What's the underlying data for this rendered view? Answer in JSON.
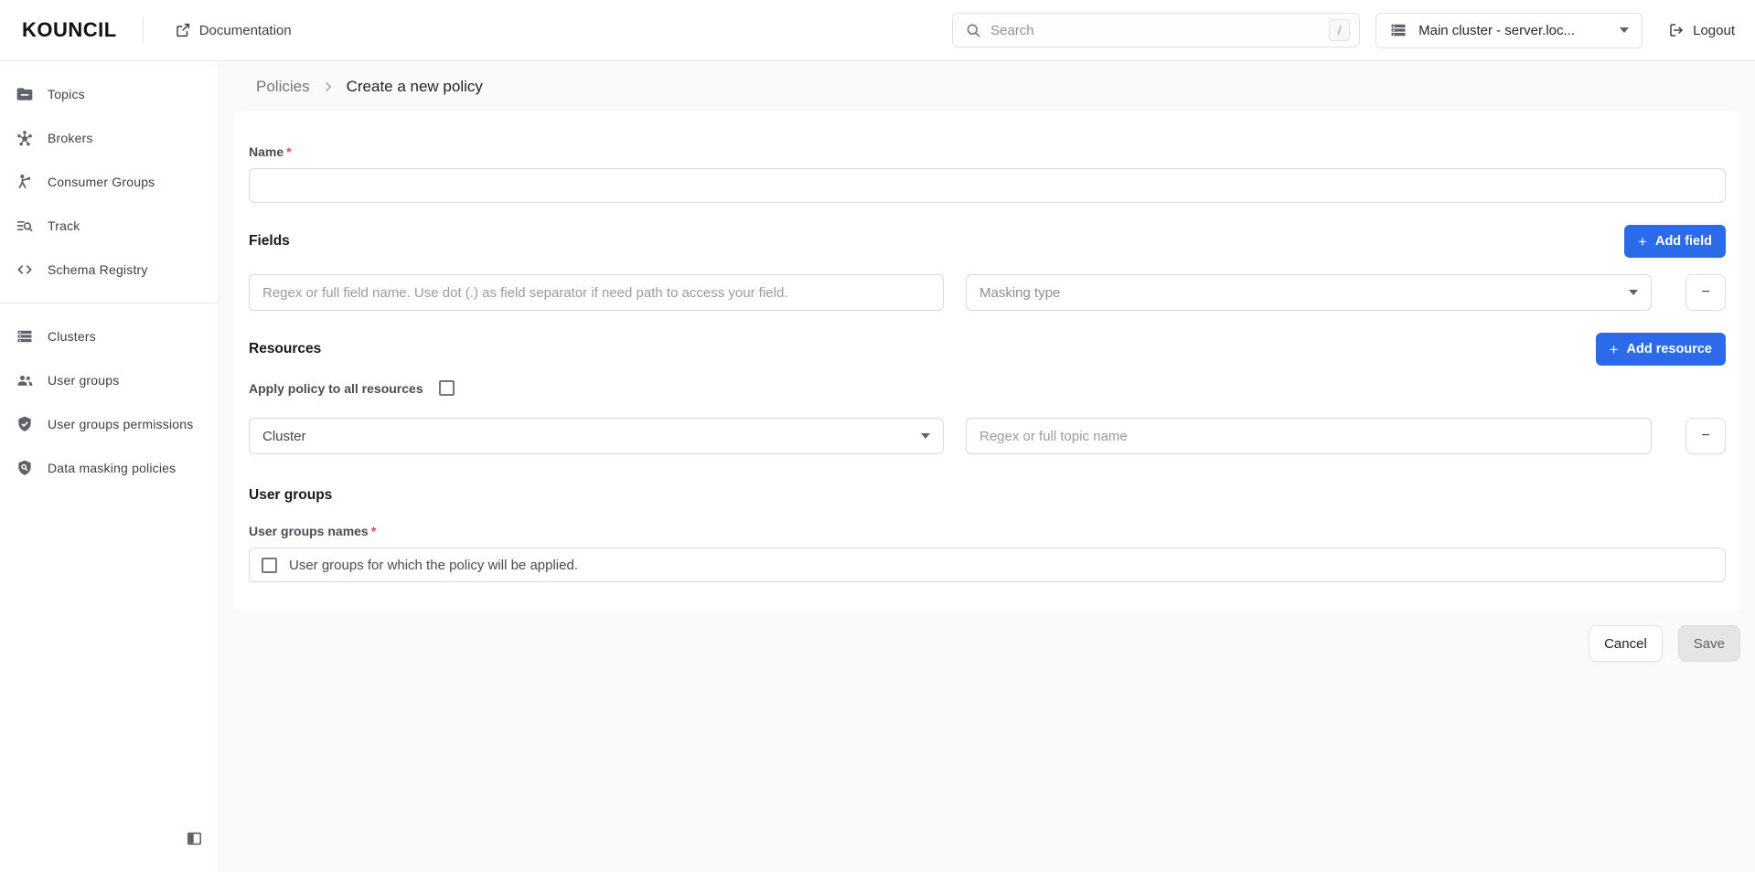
{
  "topbar": {
    "logo": "KOUNCIL",
    "documentation": {
      "label": "Documentation"
    },
    "search": {
      "placeholder": "Search",
      "value": "",
      "shortcut_key": "/"
    },
    "cluster_select": {
      "value": "Main cluster - server.loc..."
    },
    "logout": {
      "label": "Logout"
    }
  },
  "sidebar": {
    "primary_items": [
      {
        "icon": "topics-folder-icon",
        "label": "Topics"
      },
      {
        "icon": "brokers-hub-icon",
        "label": "Brokers"
      },
      {
        "icon": "consumer-groups-icon",
        "label": "Consumer Groups"
      },
      {
        "icon": "track-search-icon",
        "label": "Track"
      },
      {
        "icon": "schema-registry-code-icon",
        "label": "Schema Registry"
      }
    ],
    "secondary_items": [
      {
        "icon": "clusters-storage-icon",
        "label": "Clusters"
      },
      {
        "icon": "user-groups-people-icon",
        "label": "User groups"
      },
      {
        "icon": "user-groups-permissions-shield-icon",
        "label": "User groups permissions"
      },
      {
        "icon": "data-masking-policies-shield-search-icon",
        "label": "Data masking policies"
      }
    ]
  },
  "breadcrumb": {
    "parent": "Policies",
    "current": "Create a new policy"
  },
  "form": {
    "name": {
      "label": "Name",
      "required_marker": "*",
      "value": ""
    },
    "fields": {
      "heading": "Fields",
      "add_button": {
        "plus": "+",
        "label": "Add field"
      },
      "field_input": {
        "value": "",
        "placeholder": "Regex or full field name. Use dot (.) as field separator if need path to access your field."
      },
      "masking_type_select": {
        "placeholder": "Masking type"
      },
      "remove_button": {
        "label": "−"
      }
    },
    "resources": {
      "heading": "Resources",
      "add_button": {
        "plus": "+",
        "label": "Add resource"
      },
      "apply_all": {
        "label": "Apply policy to all resources",
        "checked": false
      },
      "resource_type_select": {
        "value": "Cluster"
      },
      "topic_input": {
        "value": "",
        "placeholder": "Regex or full topic name"
      },
      "remove_button": {
        "label": "−"
      }
    },
    "user_groups": {
      "heading": "User groups",
      "names_label": "User groups names",
      "required_marker": "*",
      "selector_placeholder": "User groups for which the policy will be applied.",
      "checked": false
    },
    "actions": {
      "cancel_label": "Cancel",
      "save_label": "Save"
    }
  },
  "colors": {
    "accent_blue": "#2b6ae8",
    "required_red": "#f0436a",
    "page_background": "#fafafa"
  }
}
